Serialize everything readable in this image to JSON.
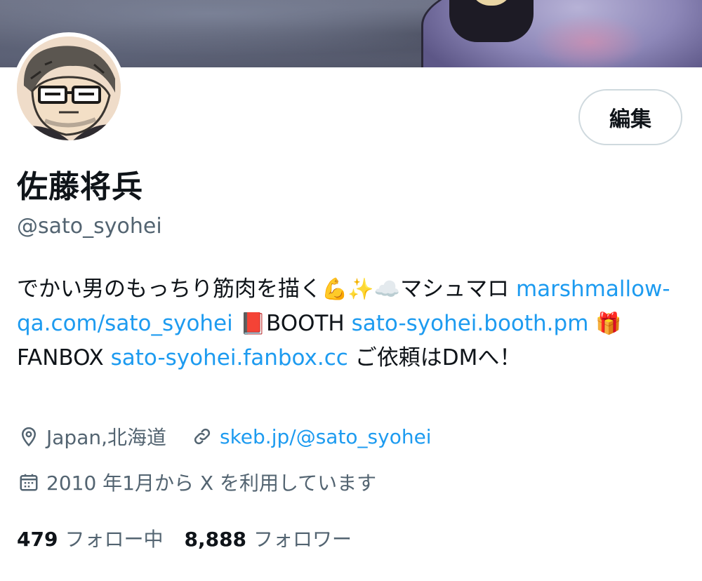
{
  "profile": {
    "display_name": "佐藤将兵",
    "handle": "@sato_syohei",
    "edit_label": "編集"
  },
  "bio": {
    "part1": "でかい男のもっちり筋肉を描く",
    "emoji_muscle": "💪",
    "emoji_sparkles": "✨",
    "emoji_cloud": "☁️",
    "part2": "マシュマロ ",
    "link_marshmallow": "marshmallow-qa.com/sato_syohei",
    "emoji_book": "📕",
    "part3": "BOOTH ",
    "link_booth": "sato-syohei.booth.pm",
    "emoji_gift": "🎁",
    "part4": "FANBOX ",
    "link_fanbox": "sato-syohei.fanbox.cc",
    "part5": " ご依頼はDMへ！"
  },
  "meta": {
    "location": "Japan,北海道",
    "website": "skeb.jp/@sato_syohei",
    "joined": "2010 年1月から X を利用しています"
  },
  "stats": {
    "following_count": "479",
    "following_label": "フォロー中",
    "followers_count": "8,888",
    "followers_label": "フォロワー"
  },
  "icons": {
    "location": "location-pin-icon",
    "link": "link-icon",
    "calendar": "calendar-icon"
  },
  "colors": {
    "link": "#1d9bf0",
    "secondary_text": "#536471",
    "primary_text": "#0f1419",
    "button_border": "#cfd9de"
  }
}
